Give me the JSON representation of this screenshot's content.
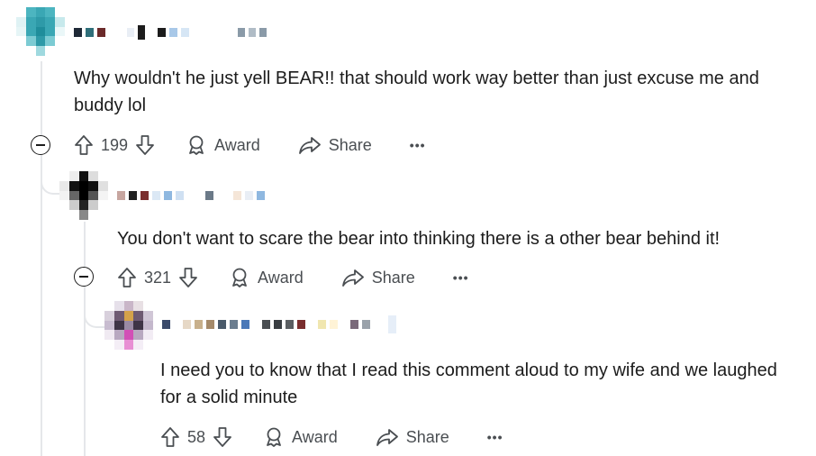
{
  "comments": [
    {
      "text": "Why wouldn't he just yell BEAR!! that should work way better than just excuse me and buddy lol",
      "votes": "199",
      "award_label": "Award",
      "share_label": "Share",
      "more_label": "•••",
      "collapse_icon": "collapse-minus-icon"
    },
    {
      "text": "You don't want to scare the bear into thinking there is a other bear behind it!",
      "votes": "321",
      "award_label": "Award",
      "share_label": "Share",
      "more_label": "•••",
      "collapse_icon": "collapse-minus-icon"
    },
    {
      "text": "I need you to know that I read this comment aloud to my wife and we laughed for a solid minute",
      "votes": "58",
      "award_label": "Award",
      "share_label": "Share",
      "more_label": "•••"
    }
  ],
  "icons": {
    "upvote": "upvote-arrow-icon",
    "downvote": "downvote-arrow-icon",
    "award": "award-icon",
    "share": "share-arrow-icon",
    "more": "more-dots-icon"
  },
  "colors": {
    "text": "#1c1c1c",
    "meta": "#4a4e52",
    "thread_line": "#e5e7ea"
  }
}
